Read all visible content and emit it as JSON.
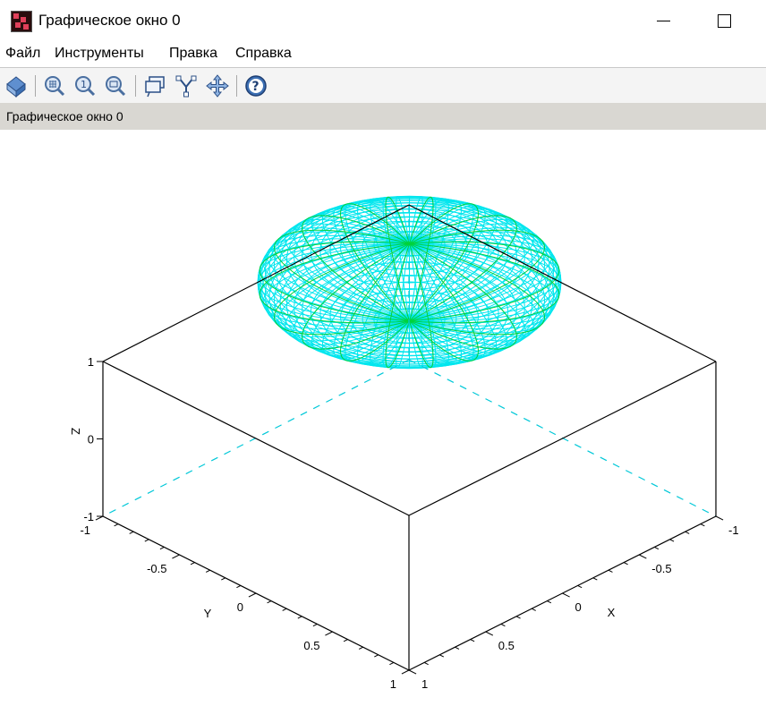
{
  "window": {
    "title": "Графическое окно 0"
  },
  "menu": [
    "Файл",
    "Инструменты",
    "Правка",
    "Справка"
  ],
  "toolbar_icons": [
    "rotate-icon",
    "zoom-grid-icon",
    "zoom-reset-icon",
    "zoom-area-icon",
    "datatip-icon",
    "edit-axes-icon",
    "pan-icon",
    "help-icon"
  ],
  "figure": {
    "label": "Графическое окно 0"
  },
  "colors": {
    "mesh_line": "#00e6ee",
    "meridian_line": "#00d23c",
    "axes": "#000000",
    "hidden_axis": "#00c8d8"
  },
  "chart_data": {
    "type": "surface",
    "surface": "ellipsoid",
    "title": "",
    "axes": {
      "x": {
        "label": "X",
        "range": [
          -1,
          1
        ],
        "ticks": [
          "-1",
          "-0.5",
          "0",
          "0.5",
          "1"
        ]
      },
      "y": {
        "label": "Y",
        "range": [
          -1,
          1
        ],
        "ticks": [
          "-1",
          "-0.5",
          "0",
          "0.5",
          "1"
        ]
      },
      "z": {
        "label": "Z",
        "range": [
          -1,
          1
        ],
        "ticks": [
          "-1",
          "0",
          "1"
        ]
      }
    }
  }
}
